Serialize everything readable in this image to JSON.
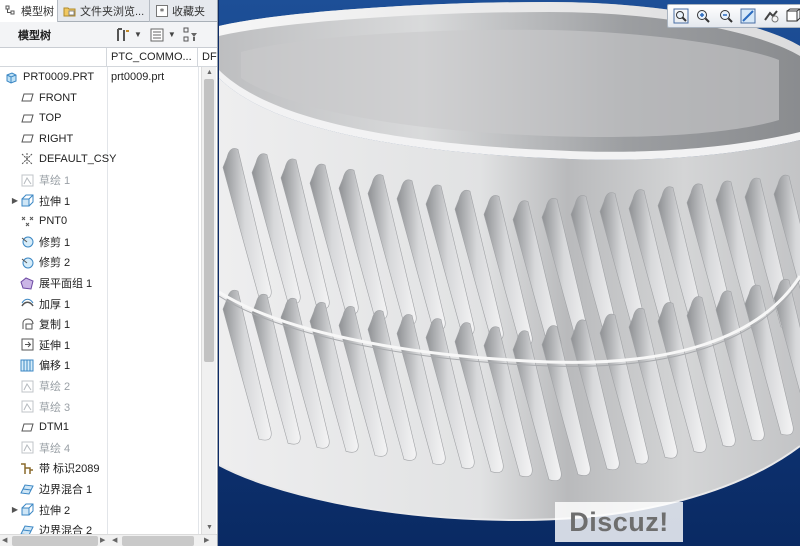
{
  "tabs": [
    {
      "label": "模型树",
      "icon": "model-tree-icon"
    },
    {
      "label": "文件夹浏览...",
      "icon": "folder-browser-icon"
    },
    {
      "label": "收藏夹",
      "icon": "favorites-icon"
    }
  ],
  "toolbar": {
    "title": "模型树",
    "settings_icon": "tree-settings-icon",
    "columns_icon": "tree-columns-icon",
    "filter_icon": "tree-filter-icon"
  },
  "columns": [
    "",
    "PTC_COMMO...",
    "DF"
  ],
  "tree": [
    {
      "label": "PRT0009.PRT",
      "col2": "prt0009.prt",
      "icon": "part-icon",
      "expander": "",
      "dim": false
    },
    {
      "label": "FRONT",
      "icon": "datum-plane-icon",
      "expander": "",
      "dim": false
    },
    {
      "label": "TOP",
      "icon": "datum-plane-icon",
      "expander": "",
      "dim": false
    },
    {
      "label": "RIGHT",
      "icon": "datum-plane-icon",
      "expander": "",
      "dim": false
    },
    {
      "label": "DEFAULT_CSY",
      "icon": "coordinate-system-icon",
      "expander": "",
      "dim": false
    },
    {
      "label": "草绘 1",
      "icon": "sketch-icon",
      "expander": "",
      "dim": true
    },
    {
      "label": "拉伸 1",
      "icon": "extrude-icon",
      "expander": "▶",
      "dim": false
    },
    {
      "label": "PNT0",
      "icon": "datum-point-icon",
      "expander": "",
      "dim": false
    },
    {
      "label": "修剪 1",
      "icon": "trim-icon",
      "expander": "",
      "dim": false
    },
    {
      "label": "修剪 2",
      "icon": "trim-icon",
      "expander": "",
      "dim": false
    },
    {
      "label": "展平面组 1",
      "icon": "flatten-quilt-icon",
      "expander": "",
      "dim": false
    },
    {
      "label": "加厚 1",
      "icon": "thicken-icon",
      "expander": "",
      "dim": false
    },
    {
      "label": "复制 1",
      "icon": "copy-icon",
      "expander": "",
      "dim": false
    },
    {
      "label": "延伸 1",
      "icon": "extend-icon",
      "expander": "",
      "dim": false
    },
    {
      "label": "偏移 1",
      "icon": "offset-icon",
      "expander": "",
      "dim": false
    },
    {
      "label": "草绘 2",
      "icon": "sketch-icon",
      "expander": "",
      "dim": true
    },
    {
      "label": "草绘 3",
      "icon": "sketch-icon",
      "expander": "",
      "dim": true
    },
    {
      "label": "DTM1",
      "icon": "datum-plane-icon",
      "expander": "",
      "dim": false
    },
    {
      "label": "草绘 4",
      "icon": "sketch-icon",
      "expander": "",
      "dim": true
    },
    {
      "label": "带 标识2089",
      "icon": "ribbon-icon",
      "expander": "",
      "dim": false
    },
    {
      "label": "边界混合 1",
      "icon": "boundary-blend-icon",
      "expander": "",
      "dim": false
    },
    {
      "label": "拉伸 2",
      "icon": "extrude-icon",
      "expander": "▶",
      "dim": false
    },
    {
      "label": "边界混合 2",
      "icon": "boundary-blend-icon",
      "expander": "",
      "dim": false
    }
  ],
  "view_tools": [
    "refit-icon",
    "zoom-in-icon",
    "zoom-out-icon",
    "repaint-icon",
    "display-style-icon",
    "saved-views-icon"
  ],
  "watermark": "Discuz!",
  "colors": {
    "viewport_bg": "#10397d",
    "model": "#d9dadb"
  }
}
